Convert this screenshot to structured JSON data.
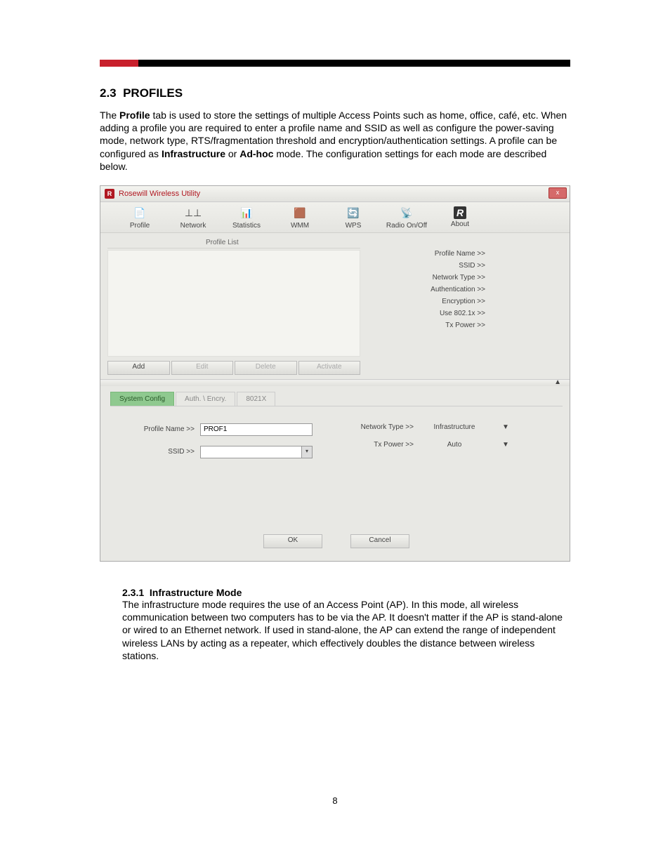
{
  "doc": {
    "section_number": "2.3",
    "section_title": "PROFILES",
    "para1_a": "The ",
    "para1_bold1": "Profile",
    "para1_b": " tab is used to store the settings of multiple Access Points such as home, office, café, etc. When adding a profile you are required to enter a profile name and SSID as well as configure the power-saving mode, network type, RTS/fragmentation threshold and encryption/authentication settings.  A profile can be configured as ",
    "para1_bold2": "Infrastructure",
    "para1_c": " or ",
    "para1_bold3": "Ad-hoc",
    "para1_d": " mode. The configuration settings for each mode are described below.",
    "subsection_number": "2.3.1",
    "subsection_title": "Infrastructure Mode",
    "subsection_text": "The infrastructure mode requires the use of an Access Point (AP). In this mode, all wireless communication between two computers has to be via the AP. It doesn't matter if the AP is stand-alone or wired to an Ethernet network. If used in stand-alone, the AP can extend the range of independent wireless LANs by acting as a repeater, which effectively doubles the distance between wireless stations.",
    "page_number": "8"
  },
  "app": {
    "window_title": "Rosewill Wireless Utility",
    "logo_letter": "R",
    "close_x": "x",
    "toolbar": [
      {
        "label": "Profile",
        "icon": "📄"
      },
      {
        "label": "Network",
        "icon": "⊥⊥"
      },
      {
        "label": "Statistics",
        "icon": "📊"
      },
      {
        "label": "WMM",
        "icon": "🟫"
      },
      {
        "label": "WPS",
        "icon": "🔄"
      },
      {
        "label": "Radio On/Off",
        "icon": "📡"
      },
      {
        "label": "About",
        "icon": "R"
      }
    ],
    "profile_list_label": "Profile List",
    "list_buttons": {
      "add": "Add",
      "edit": "Edit",
      "delete": "Delete",
      "activate": "Activate"
    },
    "details": [
      "Profile Name >>",
      "SSID >>",
      "Network Type >>",
      "Authentication >>",
      "Encryption >>",
      "Use 802.1x >>",
      "Tx Power >>"
    ],
    "collapse_glyph": "▲",
    "config_tabs": {
      "system": "System Config",
      "auth": "Auth. \\ Encry.",
      "x8021": "8021X"
    },
    "config_fields": {
      "profile_name_label": "Profile Name >>",
      "profile_name_value": "PROF1",
      "ssid_label": "SSID >>",
      "network_type_label": "Network Type >>",
      "network_type_value": "Infrastructure",
      "tx_power_label": "Tx Power >>",
      "tx_power_value": "Auto",
      "dd_glyph": "▼"
    },
    "bottom_buttons": {
      "ok": "OK",
      "cancel": "Cancel"
    }
  }
}
